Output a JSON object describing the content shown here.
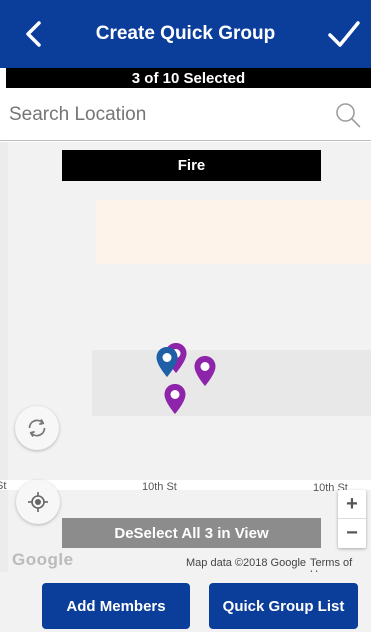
{
  "header": {
    "title": "Create Quick Group",
    "back_icon": "chevron-left-icon",
    "confirm_icon": "checkmark-icon",
    "background": "#0b3e9a"
  },
  "selection": {
    "status": "3 of 10 Selected"
  },
  "search": {
    "placeholder": "Search Location",
    "value": "",
    "icon": "search-icon"
  },
  "map": {
    "category_label": "Fire",
    "street_labels": [
      "10th St",
      "10th St",
      "St"
    ],
    "pins": [
      {
        "color": "#1f5fa8",
        "icon": "map-pin-icon"
      },
      {
        "color": "#8e24aa",
        "icon": "map-pin-icon"
      },
      {
        "color": "#8e24aa",
        "icon": "map-pin-icon"
      },
      {
        "color": "#8e24aa",
        "icon": "map-pin-icon"
      }
    ],
    "refresh_icon": "refresh-icon",
    "locate_icon": "my-location-icon",
    "zoom_in_label": "+",
    "zoom_out_label": "−",
    "deselect_label": "DeSelect All 3 in View",
    "google_logo": "Google",
    "credit": "Map data ©2018 Google",
    "terms": "Terms of Use"
  },
  "footer": {
    "add_members_label": "Add Members",
    "quick_group_list_label": "Quick Group List"
  }
}
